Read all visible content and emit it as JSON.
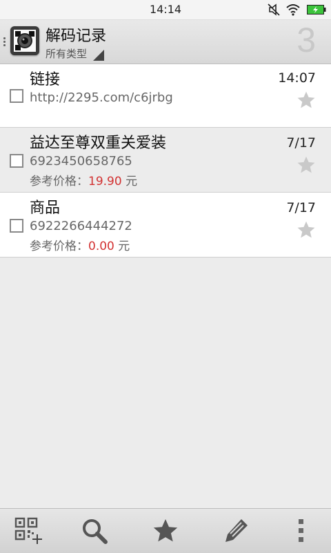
{
  "status_bar": {
    "time": "14:14"
  },
  "header": {
    "title": "解码记录",
    "filter": "所有类型",
    "count": "3"
  },
  "records": [
    {
      "title": "链接",
      "line1": "http://2295.com/c6jrbg",
      "price_label": "",
      "price": "",
      "unit": "",
      "date": "14:07"
    },
    {
      "title": "益达至尊双重关爱装",
      "line1": "6923450658765",
      "price_label": "参考价格：",
      "price": "19.90",
      "unit": "元",
      "date": "7/17"
    },
    {
      "title": "商品",
      "line1": "6922266444272",
      "price_label": "参考价格：",
      "price": "0.00",
      "unit": "元",
      "date": "7/17"
    }
  ],
  "icons": {
    "status": [
      "mute-icon",
      "wifi-icon",
      "battery-icon"
    ],
    "bottom": [
      "qr-add-icon",
      "search-icon",
      "star-icon",
      "edit-icon",
      "overflow-menu-icon"
    ]
  },
  "colors": {
    "price": "#d23131",
    "star": "#c9c9c9",
    "battery": "#3cc43c"
  }
}
